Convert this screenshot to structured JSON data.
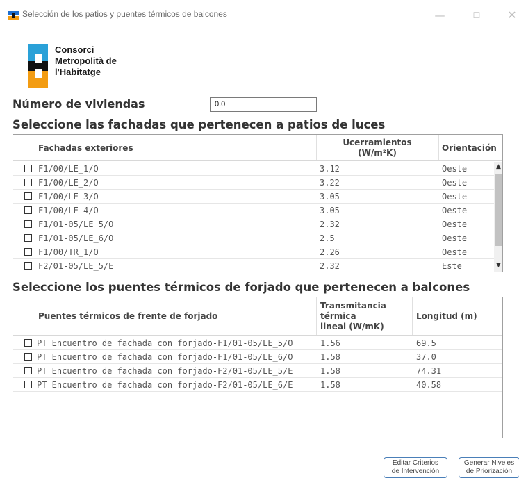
{
  "window": {
    "title": "Selección de los patios y puentes térmicos de balcones",
    "controls": {
      "minimize": "—",
      "maximize": "☐",
      "close": "✕"
    }
  },
  "logo": {
    "line1": "Consorci",
    "line2": "Metropolità de",
    "line3": "l'Habitatge"
  },
  "viviendas": {
    "label": "Número de viviendas",
    "value": "0.0"
  },
  "patios": {
    "title": "Seleccione las fachadas que pertenecen a patios de luces",
    "headers": {
      "col1": "Fachadas exteriores",
      "col2a": "Ucerramientos",
      "col2b": "(W/m²K)",
      "col3": "Orientación"
    },
    "rows": [
      {
        "name": "F1/00/LE_1/O",
        "u": "3.12",
        "orient": "Oeste"
      },
      {
        "name": "F1/00/LE_2/O",
        "u": "3.22",
        "orient": "Oeste"
      },
      {
        "name": "F1/00/LE_3/O",
        "u": "3.05",
        "orient": "Oeste"
      },
      {
        "name": "F1/00/LE_4/O",
        "u": "3.05",
        "orient": "Oeste"
      },
      {
        "name": "F1/01-05/LE_5/O",
        "u": "2.32",
        "orient": "Oeste"
      },
      {
        "name": "F1/01-05/LE_6/O",
        "u": "2.5",
        "orient": "Oeste"
      },
      {
        "name": "F1/00/TR_1/O",
        "u": "2.26",
        "orient": "Oeste"
      },
      {
        "name": "F2/01-05/LE_5/E",
        "u": "2.32",
        "orient": "Este"
      }
    ],
    "scroll": {
      "up": "▲",
      "down": "▼"
    }
  },
  "puentes": {
    "title": "Seleccione los puentes térmicos de forjado que pertenecen a balcones",
    "headers": {
      "col1": "Puentes térmicos de frente de forjado",
      "col2a": "Transmitancia",
      "col2b": "térmica",
      "col2c": "lineal (W/mK)",
      "col3": "Longitud (m)"
    },
    "rows": [
      {
        "name": "PT Encuentro de fachada con forjado-F1/01-05/LE_5/O",
        "t": "1.56",
        "len": "69.5"
      },
      {
        "name": "PT Encuentro de fachada con forjado-F1/01-05/LE_6/O",
        "t": "1.58",
        "len": "37.0"
      },
      {
        "name": "PT Encuentro de fachada con forjado-F2/01-05/LE_5/E",
        "t": "1.58",
        "len": "74.31"
      },
      {
        "name": "PT Encuentro de fachada con forjado-F2/01-05/LE_6/E",
        "t": "1.58",
        "len": "40.58"
      }
    ]
  },
  "buttons": {
    "edit_line1": "Editar Criterios",
    "edit_line2": "de Intervención",
    "gen_line1": "Generar Niveles",
    "gen_line2": "de Priorización"
  }
}
